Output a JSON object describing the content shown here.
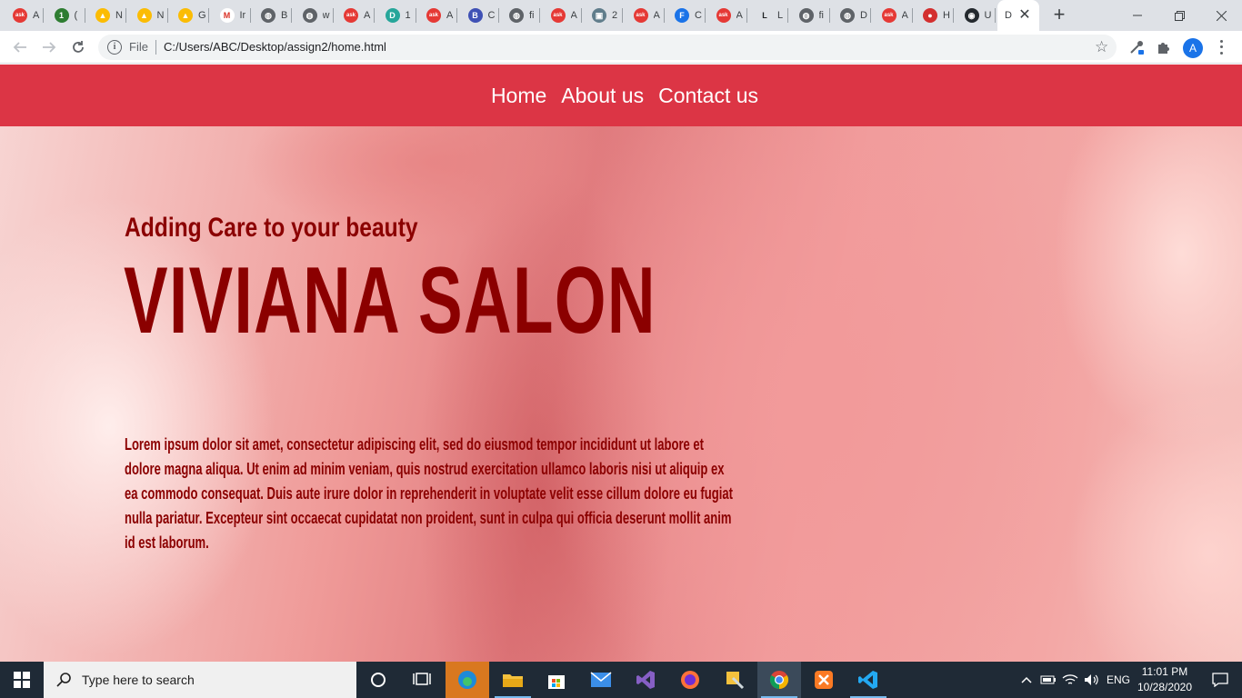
{
  "browser": {
    "tabs": [
      {
        "favicon": "ask-icon",
        "label": "A"
      },
      {
        "favicon": "green-number-icon",
        "label": "("
      },
      {
        "favicon": "drive-icon",
        "label": "N"
      },
      {
        "favicon": "drive-icon",
        "label": "N"
      },
      {
        "favicon": "drive-icon",
        "label": "G"
      },
      {
        "favicon": "gmail-icon",
        "label": "Ir"
      },
      {
        "favicon": "globe-icon",
        "label": "B"
      },
      {
        "favicon": "globe-icon",
        "label": "w"
      },
      {
        "favicon": "ask-icon",
        "label": "A"
      },
      {
        "favicon": "d-icon",
        "label": "1"
      },
      {
        "favicon": "ask-icon",
        "label": "A"
      },
      {
        "favicon": "b-icon",
        "label": "C"
      },
      {
        "favicon": "globe-icon",
        "label": "fi"
      },
      {
        "favicon": "ask-icon",
        "label": "A"
      },
      {
        "favicon": "computer-icon",
        "label": "2"
      },
      {
        "favicon": "ask-icon",
        "label": "A"
      },
      {
        "favicon": "f-icon",
        "label": "C"
      },
      {
        "favicon": "ask-icon",
        "label": "A"
      },
      {
        "favicon": "l-icon",
        "label": "L"
      },
      {
        "favicon": "globe-icon",
        "label": "fi"
      },
      {
        "favicon": "globe-icon",
        "label": "D"
      },
      {
        "favicon": "ask-icon",
        "label": "A"
      },
      {
        "favicon": "red-play-icon",
        "label": "H"
      },
      {
        "favicon": "github-icon",
        "label": "U"
      }
    ],
    "active_tab": {
      "label": "D"
    },
    "address": {
      "scheme_label": "File",
      "url": "C:/Users/ABC/Desktop/assign2/home.html"
    },
    "profile_initial": "A"
  },
  "site": {
    "nav": [
      "Home",
      "About us",
      "Contact us"
    ],
    "hero": {
      "subtitle": "Adding Care to your beauty",
      "title": "VIVIANA SALON",
      "body": "Lorem ipsum dolor sit amet, consectetur adipiscing elit, sed do eiusmod tempor incididunt ut labore et dolore magna aliqua. Ut enim ad minim veniam, quis nostrud exercitation ullamco laboris nisi ut aliquip ex ea commodo consequat. Duis aute irure dolor in reprehenderit in voluptate velit esse cillum dolore eu fugiat nulla pariatur. Excepteur sint occaecat cupidatat non proident, sunt in culpa qui officia deserunt mollit anim id est laborum."
    },
    "colors": {
      "nav_bg": "#dc3545",
      "hero_text": "#8b0000"
    }
  },
  "taskbar": {
    "search_placeholder": "Type here to search",
    "apps": [
      "task-view-icon",
      "edge-icon",
      "file-explorer-icon",
      "store-icon",
      "mail-icon",
      "visual-studio-icon",
      "firefox-icon",
      "tool-icon",
      "chrome-icon",
      "xampp-icon",
      "vscode-icon"
    ],
    "language": "ENG",
    "time": "11:01 PM",
    "date": "10/28/2020"
  }
}
